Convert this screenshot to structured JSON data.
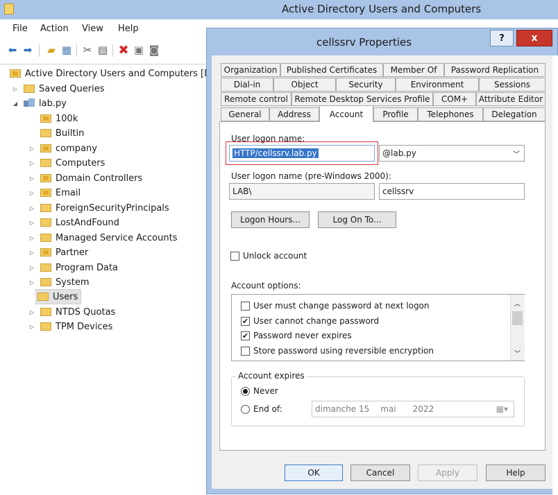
{
  "window": {
    "title": "Active Directory Users and Computers"
  },
  "menu": [
    "File",
    "Action",
    "View",
    "Help"
  ],
  "tree": {
    "root": "Active Directory Users and Computers [D",
    "items": [
      {
        "label": "Saved Queries",
        "level": 1,
        "expandable": true
      },
      {
        "label": "lab.py",
        "level": 1,
        "expanded": true
      },
      {
        "label": "100k",
        "level": 2,
        "expandable": false
      },
      {
        "label": "Builtin",
        "level": 2,
        "expandable": false
      },
      {
        "label": "company",
        "level": 2,
        "expandable": true
      },
      {
        "label": "Computers",
        "level": 2,
        "expandable": true
      },
      {
        "label": "Domain Controllers",
        "level": 2,
        "expandable": true
      },
      {
        "label": "Email",
        "level": 2,
        "expandable": true
      },
      {
        "label": "ForeignSecurityPrincipals",
        "level": 2,
        "expandable": true
      },
      {
        "label": "LostAndFound",
        "level": 2,
        "expandable": true
      },
      {
        "label": "Managed Service Accounts",
        "level": 2,
        "expandable": true
      },
      {
        "label": "Partner",
        "level": 2,
        "expandable": true
      },
      {
        "label": "Program Data",
        "level": 2,
        "expandable": true
      },
      {
        "label": "System",
        "level": 2,
        "expandable": true
      },
      {
        "label": "Users",
        "level": 2,
        "expandable": false,
        "selected": true
      },
      {
        "label": "NTDS Quotas",
        "level": 2,
        "expandable": true
      },
      {
        "label": "TPM Devices",
        "level": 2,
        "expandable": true
      }
    ]
  },
  "dialog": {
    "title": "cellssrv Properties",
    "help": "?",
    "close": "x",
    "tabs_row1": [
      "Organization",
      "Published Certificates",
      "Member Of",
      "Password Replication"
    ],
    "tabs_row2": [
      "Dial-in",
      "Object",
      "Security",
      "Environment",
      "Sessions"
    ],
    "tabs_row3": [
      "Remote control",
      "Remote Desktop Services Profile",
      "COM+",
      "Attribute Editor"
    ],
    "tabs_row4": [
      "General",
      "Address",
      "Account",
      "Profile",
      "Telephones",
      "Delegation"
    ],
    "active_tab": "Account",
    "logon_label": "User logon name:",
    "logon_name": "HTTP/cellssrv.lab.py",
    "logon_domain": "@lab.py",
    "pre2000_label": "User logon name (pre-Windows 2000):",
    "pre2000_domain": "LAB\\",
    "pre2000_name": "cellssrv",
    "logon_hours": "Logon Hours...",
    "log_on_to": "Log On To...",
    "unlock": "Unlock account",
    "options_label": "Account options:",
    "options": [
      {
        "label": "User must change password at next logon",
        "checked": false
      },
      {
        "label": "User cannot change password",
        "checked": true
      },
      {
        "label": "Password never expires",
        "checked": true
      },
      {
        "label": "Store password using reversible encryption",
        "checked": false
      }
    ],
    "expires_label": "Account expires",
    "never": "Never",
    "end_of": "End of:",
    "date_day": "dimanche 15",
    "date_month": "mai",
    "date_year": "2022",
    "ok": "OK",
    "cancel": "Cancel",
    "apply": "Apply",
    "help_btn": "Help"
  }
}
